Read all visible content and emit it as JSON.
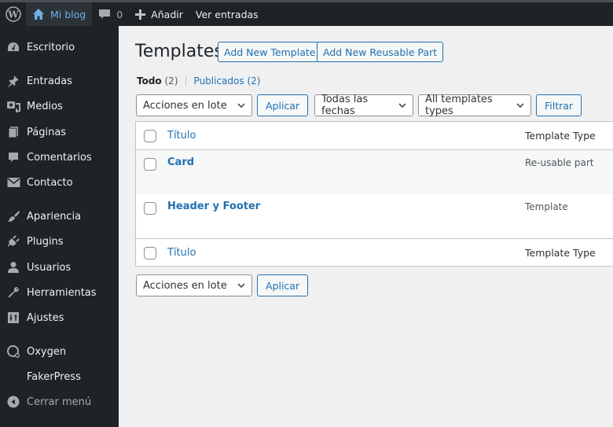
{
  "adminbar": {
    "wp_logo": "wordpress-logo",
    "site_name": "Mi blog",
    "comments_count": "0",
    "new_label": "Añadir",
    "view_posts_label": "Ver entradas"
  },
  "sidebar": {
    "items": [
      {
        "label": "Escritorio",
        "icon": "dashboard-icon"
      },
      {
        "label": "Entradas",
        "icon": "pin-icon"
      },
      {
        "label": "Medios",
        "icon": "media-icon"
      },
      {
        "label": "Páginas",
        "icon": "pages-icon"
      },
      {
        "label": "Comentarios",
        "icon": "comment-icon"
      },
      {
        "label": "Contacto",
        "icon": "mail-icon"
      },
      {
        "label": "Apariencia",
        "icon": "brush-icon"
      },
      {
        "label": "Plugins",
        "icon": "plugin-icon"
      },
      {
        "label": "Usuarios",
        "icon": "user-icon"
      },
      {
        "label": "Herramientas",
        "icon": "wrench-icon"
      },
      {
        "label": "Ajustes",
        "icon": "settings-icon"
      },
      {
        "label": "Oxygen",
        "icon": "oxygen-icon"
      },
      {
        "label": "FakerPress",
        "icon": ""
      },
      {
        "label": "Cerrar menú",
        "icon": "collapse-icon"
      }
    ]
  },
  "main": {
    "title": "Templates",
    "add_new_template": "Add New Template",
    "add_new_reusable_part": "Add New Reusable Part",
    "views": {
      "all_label": "Todo",
      "all_count": "(2)",
      "published_label": "Publicados",
      "published_count": "(2)"
    },
    "filters": {
      "bulk_actions": "Acciones en lote",
      "apply": "Aplicar",
      "dates": "Todas las fechas",
      "types": "All templates types",
      "filter": "Filtrar"
    },
    "table": {
      "columns": {
        "title": "Título",
        "type": "Template Type"
      },
      "rows": [
        {
          "title": "Card",
          "type": "Re-usable part"
        },
        {
          "title": "Header y Footer",
          "type": "Template"
        }
      ]
    }
  },
  "colors": {
    "adminbar_bg": "#1d2327",
    "link": "#2271b1",
    "site_link": "#72aee6",
    "page_bg": "#f0f0f1"
  }
}
